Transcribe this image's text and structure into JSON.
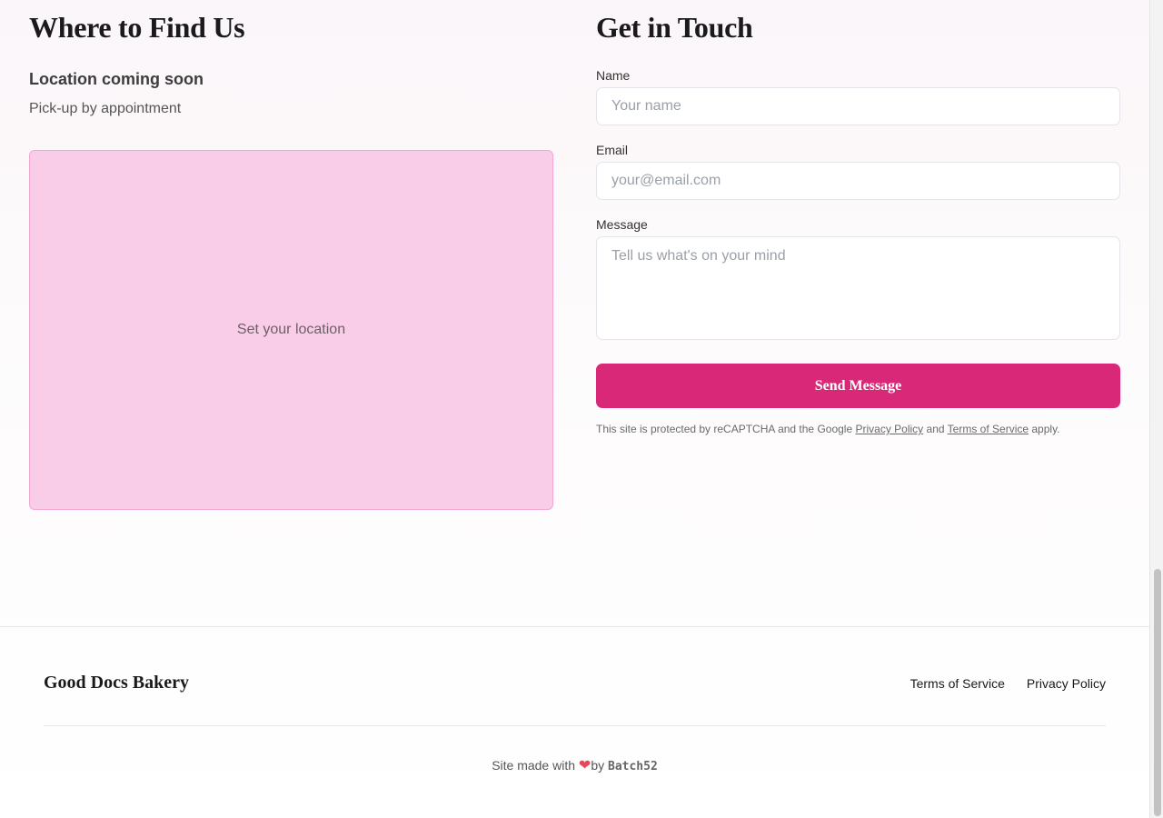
{
  "location": {
    "title": "Where to Find Us",
    "heading": "Location coming soon",
    "subtext": "Pick-up by appointment",
    "map_label": "Set your location"
  },
  "contact": {
    "title": "Get in Touch",
    "name_label": "Name",
    "name_placeholder": "Your name",
    "email_label": "Email",
    "email_placeholder": "your@email.com",
    "message_label": "Message",
    "message_placeholder": "Tell us what's on your mind",
    "submit_label": "Send Message",
    "recaptcha_prefix": "This site is protected by reCAPTCHA and the Google",
    "recaptcha_privacy": "Privacy Policy",
    "recaptcha_and": "and",
    "recaptcha_terms": "Terms of Service",
    "recaptcha_suffix": "apply."
  },
  "footer": {
    "brand": "Good Docs Bakery",
    "links": [
      "Terms of Service",
      "Privacy Policy"
    ],
    "made_with_prefix": "Site made with",
    "heart_icon": "heart-icon",
    "made_with_by": "by",
    "made_with_brand": "Batch52"
  },
  "colors": {
    "accent": "#d92877",
    "map_fill": "#f9cde8",
    "map_border": "#f0a8d2"
  }
}
